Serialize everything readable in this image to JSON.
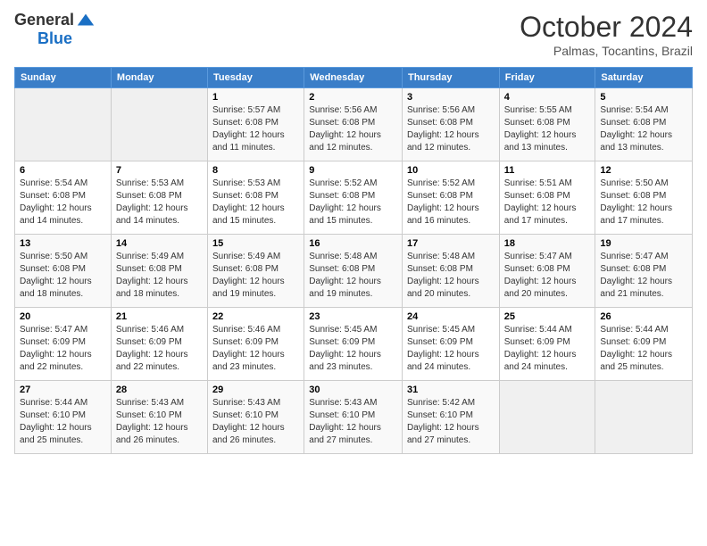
{
  "header": {
    "logo_general": "General",
    "logo_blue": "Blue",
    "month_title": "October 2024",
    "location": "Palmas, Tocantins, Brazil"
  },
  "days_of_week": [
    "Sunday",
    "Monday",
    "Tuesday",
    "Wednesday",
    "Thursday",
    "Friday",
    "Saturday"
  ],
  "weeks": [
    [
      {
        "day": "",
        "info": ""
      },
      {
        "day": "",
        "info": ""
      },
      {
        "day": "1",
        "info": "Sunrise: 5:57 AM\nSunset: 6:08 PM\nDaylight: 12 hours and 11 minutes."
      },
      {
        "day": "2",
        "info": "Sunrise: 5:56 AM\nSunset: 6:08 PM\nDaylight: 12 hours and 12 minutes."
      },
      {
        "day": "3",
        "info": "Sunrise: 5:56 AM\nSunset: 6:08 PM\nDaylight: 12 hours and 12 minutes."
      },
      {
        "day": "4",
        "info": "Sunrise: 5:55 AM\nSunset: 6:08 PM\nDaylight: 12 hours and 13 minutes."
      },
      {
        "day": "5",
        "info": "Sunrise: 5:54 AM\nSunset: 6:08 PM\nDaylight: 12 hours and 13 minutes."
      }
    ],
    [
      {
        "day": "6",
        "info": "Sunrise: 5:54 AM\nSunset: 6:08 PM\nDaylight: 12 hours and 14 minutes."
      },
      {
        "day": "7",
        "info": "Sunrise: 5:53 AM\nSunset: 6:08 PM\nDaylight: 12 hours and 14 minutes."
      },
      {
        "day": "8",
        "info": "Sunrise: 5:53 AM\nSunset: 6:08 PM\nDaylight: 12 hours and 15 minutes."
      },
      {
        "day": "9",
        "info": "Sunrise: 5:52 AM\nSunset: 6:08 PM\nDaylight: 12 hours and 15 minutes."
      },
      {
        "day": "10",
        "info": "Sunrise: 5:52 AM\nSunset: 6:08 PM\nDaylight: 12 hours and 16 minutes."
      },
      {
        "day": "11",
        "info": "Sunrise: 5:51 AM\nSunset: 6:08 PM\nDaylight: 12 hours and 17 minutes."
      },
      {
        "day": "12",
        "info": "Sunrise: 5:50 AM\nSunset: 6:08 PM\nDaylight: 12 hours and 17 minutes."
      }
    ],
    [
      {
        "day": "13",
        "info": "Sunrise: 5:50 AM\nSunset: 6:08 PM\nDaylight: 12 hours and 18 minutes."
      },
      {
        "day": "14",
        "info": "Sunrise: 5:49 AM\nSunset: 6:08 PM\nDaylight: 12 hours and 18 minutes."
      },
      {
        "day": "15",
        "info": "Sunrise: 5:49 AM\nSunset: 6:08 PM\nDaylight: 12 hours and 19 minutes."
      },
      {
        "day": "16",
        "info": "Sunrise: 5:48 AM\nSunset: 6:08 PM\nDaylight: 12 hours and 19 minutes."
      },
      {
        "day": "17",
        "info": "Sunrise: 5:48 AM\nSunset: 6:08 PM\nDaylight: 12 hours and 20 minutes."
      },
      {
        "day": "18",
        "info": "Sunrise: 5:47 AM\nSunset: 6:08 PM\nDaylight: 12 hours and 20 minutes."
      },
      {
        "day": "19",
        "info": "Sunrise: 5:47 AM\nSunset: 6:08 PM\nDaylight: 12 hours and 21 minutes."
      }
    ],
    [
      {
        "day": "20",
        "info": "Sunrise: 5:47 AM\nSunset: 6:09 PM\nDaylight: 12 hours and 22 minutes."
      },
      {
        "day": "21",
        "info": "Sunrise: 5:46 AM\nSunset: 6:09 PM\nDaylight: 12 hours and 22 minutes."
      },
      {
        "day": "22",
        "info": "Sunrise: 5:46 AM\nSunset: 6:09 PM\nDaylight: 12 hours and 23 minutes."
      },
      {
        "day": "23",
        "info": "Sunrise: 5:45 AM\nSunset: 6:09 PM\nDaylight: 12 hours and 23 minutes."
      },
      {
        "day": "24",
        "info": "Sunrise: 5:45 AM\nSunset: 6:09 PM\nDaylight: 12 hours and 24 minutes."
      },
      {
        "day": "25",
        "info": "Sunrise: 5:44 AM\nSunset: 6:09 PM\nDaylight: 12 hours and 24 minutes."
      },
      {
        "day": "26",
        "info": "Sunrise: 5:44 AM\nSunset: 6:09 PM\nDaylight: 12 hours and 25 minutes."
      }
    ],
    [
      {
        "day": "27",
        "info": "Sunrise: 5:44 AM\nSunset: 6:10 PM\nDaylight: 12 hours and 25 minutes."
      },
      {
        "day": "28",
        "info": "Sunrise: 5:43 AM\nSunset: 6:10 PM\nDaylight: 12 hours and 26 minutes."
      },
      {
        "day": "29",
        "info": "Sunrise: 5:43 AM\nSunset: 6:10 PM\nDaylight: 12 hours and 26 minutes."
      },
      {
        "day": "30",
        "info": "Sunrise: 5:43 AM\nSunset: 6:10 PM\nDaylight: 12 hours and 27 minutes."
      },
      {
        "day": "31",
        "info": "Sunrise: 5:42 AM\nSunset: 6:10 PM\nDaylight: 12 hours and 27 minutes."
      },
      {
        "day": "",
        "info": ""
      },
      {
        "day": "",
        "info": ""
      }
    ]
  ]
}
